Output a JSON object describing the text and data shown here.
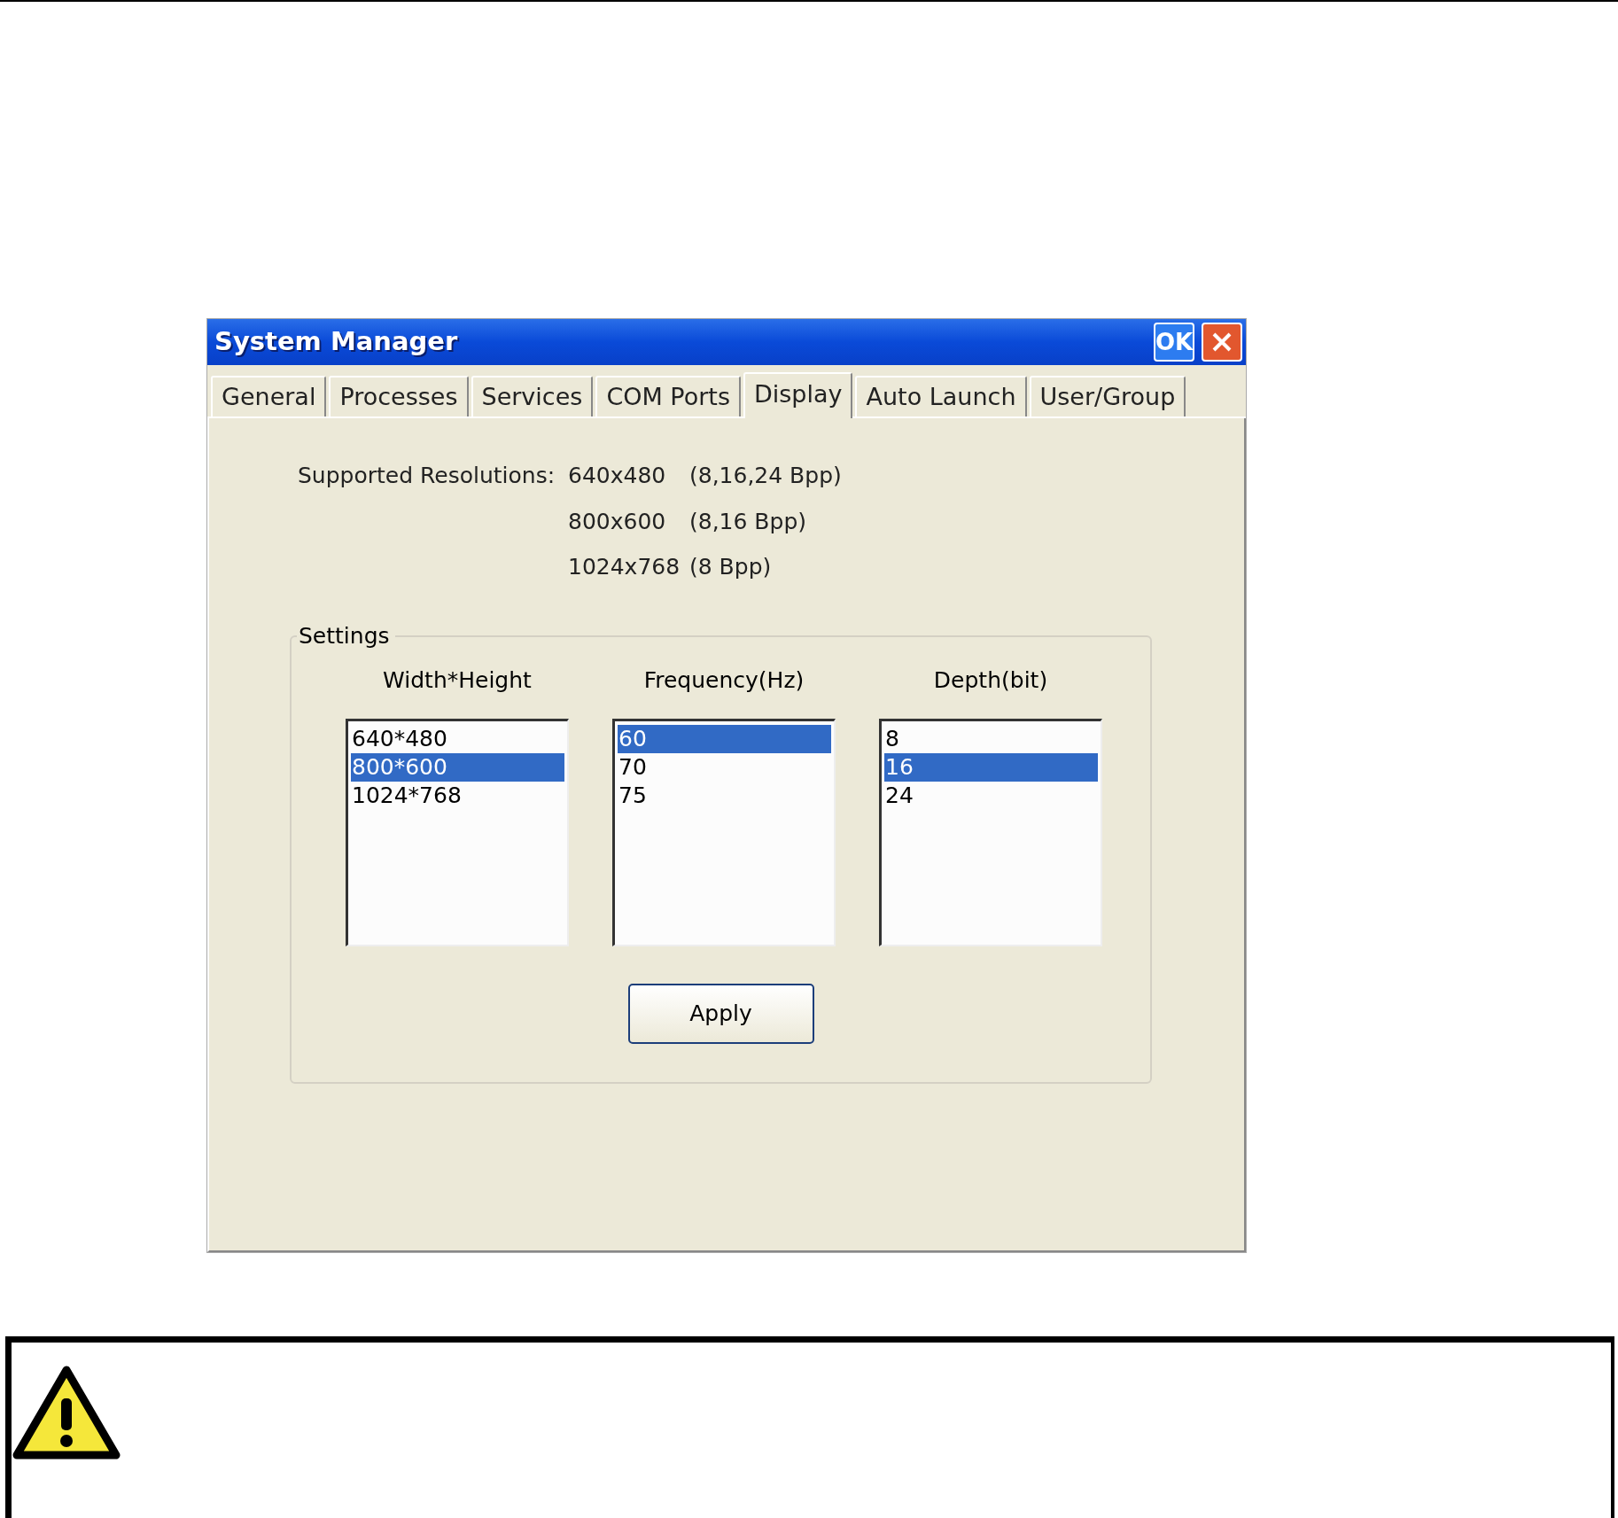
{
  "window": {
    "title": "System Manager",
    "ok_button": "OK"
  },
  "tabs": [
    {
      "label": "General",
      "selected": false
    },
    {
      "label": "Processes",
      "selected": false
    },
    {
      "label": "Services",
      "selected": false
    },
    {
      "label": "COM Ports",
      "selected": false
    },
    {
      "label": "Display",
      "selected": true
    },
    {
      "label": "Auto Launch",
      "selected": false
    },
    {
      "label": "User/Group",
      "selected": false
    }
  ],
  "supported_resolutions": {
    "label": "Supported Resolutions:",
    "rows": [
      {
        "resolution": "640x480",
        "depths": "(8,16,24 Bpp)"
      },
      {
        "resolution": "800x600",
        "depths": "(8,16 Bpp)"
      },
      {
        "resolution": "1024x768",
        "depths": "(8 Bpp)"
      }
    ]
  },
  "settings": {
    "title": "Settings",
    "lists": [
      {
        "heading": "Width*Height",
        "items": [
          {
            "label": "640*480",
            "selected": false
          },
          {
            "label": "800*600",
            "selected": true
          },
          {
            "label": "1024*768",
            "selected": false
          }
        ]
      },
      {
        "heading": "Frequency(Hz)",
        "items": [
          {
            "label": "60",
            "selected": true
          },
          {
            "label": "70",
            "selected": false
          },
          {
            "label": "75",
            "selected": false
          }
        ]
      },
      {
        "heading": "Depth(bit)",
        "items": [
          {
            "label": "8",
            "selected": false
          },
          {
            "label": "16",
            "selected": true
          },
          {
            "label": "24",
            "selected": false
          }
        ]
      }
    ],
    "apply_button": "Apply"
  }
}
